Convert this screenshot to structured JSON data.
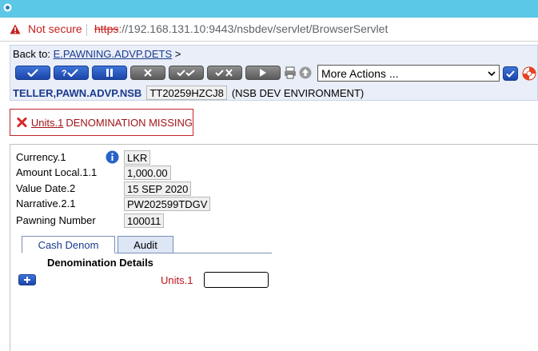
{
  "browser": {
    "security_label": "Not secure",
    "url_scheme": "https",
    "url_rest": "://192.168.131.10:9443/nsbdev/servlet/BrowserServlet"
  },
  "toolbar": {
    "back_to_label": "Back to:",
    "back_to_link": "E.PAWNING.ADVP.DETS",
    "back_to_arrow": ">",
    "more_actions_value": "More Actions ...",
    "version_name": "TELLER,PAWN.ADVP.NSB",
    "transaction_id": "TT20259HZCJ8",
    "environment": "(NSB DEV ENVIRONMENT)",
    "buttons": [
      "commit-icon",
      "validate-icon",
      "hold-icon",
      "delete-icon",
      "authorise-icon",
      "reverse-icon",
      "next-icon",
      "print-icon",
      "upload-icon"
    ]
  },
  "error": {
    "field": "Units.1",
    "message": "DENOMINATION MISSING",
    "color": "#a01419"
  },
  "fields": {
    "currency_label": "Currency.1",
    "currency_value": "LKR",
    "amount_label": "Amount Local.1.1",
    "amount_value": "1,000.00",
    "value_date_label": "Value Date.2",
    "value_date_value": "15 SEP 2020",
    "narrative_label": "Narrative.2.1",
    "narrative_value": "PW202599TDGV",
    "pawning_label": "Pawning Number",
    "pawning_value": "100011"
  },
  "tabs": {
    "cash_denom": "Cash Denom",
    "audit": "Audit",
    "active": "Cash Denom"
  },
  "denomination": {
    "section_title": "Denomination Details",
    "units_label": "Units.1",
    "units_value": ""
  }
}
